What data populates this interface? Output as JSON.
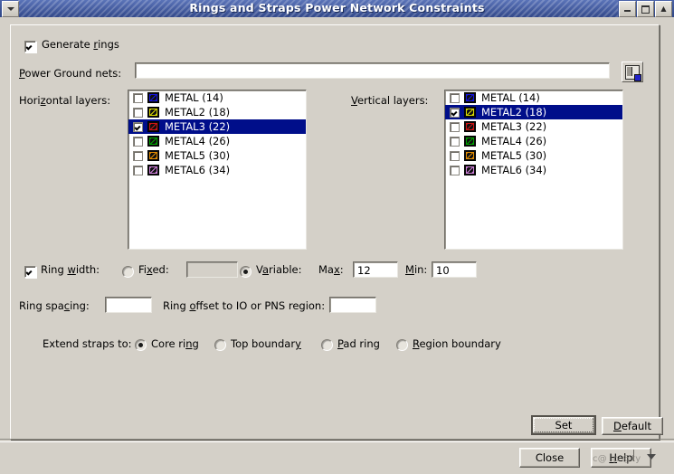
{
  "window": {
    "title": "Rings and Straps Power Network Constraints",
    "sys_menu_icon": "window-menu-icon",
    "minimize_icon": "minimize-icon",
    "maximize_icon": "maximize-icon",
    "close_icon": "close-icon"
  },
  "form": {
    "generate_rings": {
      "label": "Generate rings",
      "checked": true
    },
    "power_ground_nets": {
      "label": "Power Ground nets:",
      "value": "",
      "placeholder": ""
    },
    "browse_icon": "net-picker-icon",
    "horizontal": {
      "label": "Horizontal layers:",
      "items": [
        {
          "name": "METAL (14)",
          "checked": false,
          "selected": false,
          "color": "#1414dc"
        },
        {
          "name": "METAL2 (18)",
          "checked": false,
          "selected": false,
          "color": "#d8d800"
        },
        {
          "name": "METAL3 (22)",
          "checked": true,
          "selected": true,
          "color": "#cc1414"
        },
        {
          "name": "METAL4 (26)",
          "checked": false,
          "selected": false,
          "color": "#00a000"
        },
        {
          "name": "METAL5 (30)",
          "checked": false,
          "selected": false,
          "color": "#e08a00"
        },
        {
          "name": "METAL6 (34)",
          "checked": false,
          "selected": false,
          "color": "#cc7fd8"
        }
      ]
    },
    "vertical": {
      "label": "Vertical layers:",
      "items": [
        {
          "name": "METAL (14)",
          "checked": false,
          "selected": false,
          "color": "#1414dc"
        },
        {
          "name": "METAL2 (18)",
          "checked": true,
          "selected": true,
          "color": "#d8d800"
        },
        {
          "name": "METAL3 (22)",
          "checked": false,
          "selected": false,
          "color": "#cc1414"
        },
        {
          "name": "METAL4 (26)",
          "checked": false,
          "selected": false,
          "color": "#00a000"
        },
        {
          "name": "METAL5 (30)",
          "checked": false,
          "selected": false,
          "color": "#e08a00"
        },
        {
          "name": "METAL6 (34)",
          "checked": false,
          "selected": false,
          "color": "#cc7fd8"
        }
      ]
    },
    "ring_width": {
      "label": "Ring width:",
      "checked": true,
      "fixed": {
        "label": "Fixed:",
        "selected": false,
        "value": ""
      },
      "variable": {
        "label": "Variable:",
        "selected": true
      },
      "max": {
        "label": "Max:",
        "value": "12"
      },
      "min": {
        "label": "Min:",
        "value": "10"
      }
    },
    "ring_spacing": {
      "label": "Ring spacing:",
      "value": ""
    },
    "ring_offset": {
      "label": "Ring offset to IO or PNS region:",
      "value": ""
    },
    "extend_straps": {
      "label": "Extend straps to:",
      "options": [
        {
          "label": "Core ring",
          "selected": true
        },
        {
          "label": "Top boundary",
          "selected": false
        },
        {
          "label": "Pad ring",
          "selected": false
        },
        {
          "label": "Region boundary",
          "selected": false
        }
      ]
    }
  },
  "buttons": {
    "set": "Set",
    "default": "Default",
    "close": "Close",
    "help": "Help",
    "watermark": "c@ ip @ty"
  },
  "colors": {
    "face": "#d4d0c8",
    "selection": "#000e8a",
    "title_start": "#4a63a8",
    "title_end": "#2f4685"
  }
}
